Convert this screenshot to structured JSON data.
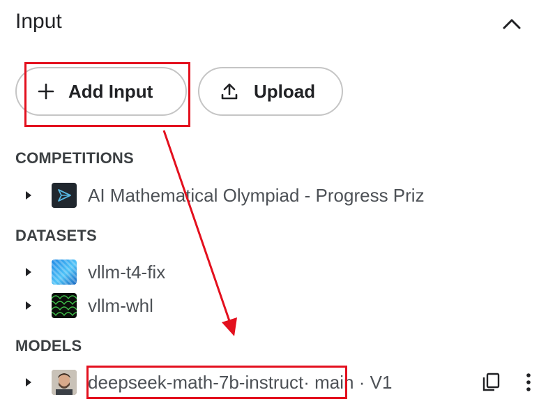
{
  "panel": {
    "title": "Input"
  },
  "buttons": {
    "add_input": "Add Input",
    "upload": "Upload"
  },
  "sections": [
    {
      "heading": "COMPETITIONS",
      "items": [
        {
          "label": "AI Mathematical Olympiad - Progress Priz",
          "icon": "competition-icon"
        }
      ]
    },
    {
      "heading": "DATASETS",
      "items": [
        {
          "label": "vllm-t4-fix",
          "icon": "dataset-thumbnail"
        },
        {
          "label": "vllm-whl",
          "icon": "dataset-thumbnail"
        }
      ]
    },
    {
      "heading": "MODELS",
      "items": [
        {
          "label": "deepseek-math-7b-instruct",
          "meta": " · main · V1",
          "icon": "user-avatar"
        }
      ]
    }
  ],
  "colors": {
    "annotation": "#e3101e",
    "text": "#202124",
    "muted_text": "#4d5156",
    "border": "#c5c5c5"
  }
}
